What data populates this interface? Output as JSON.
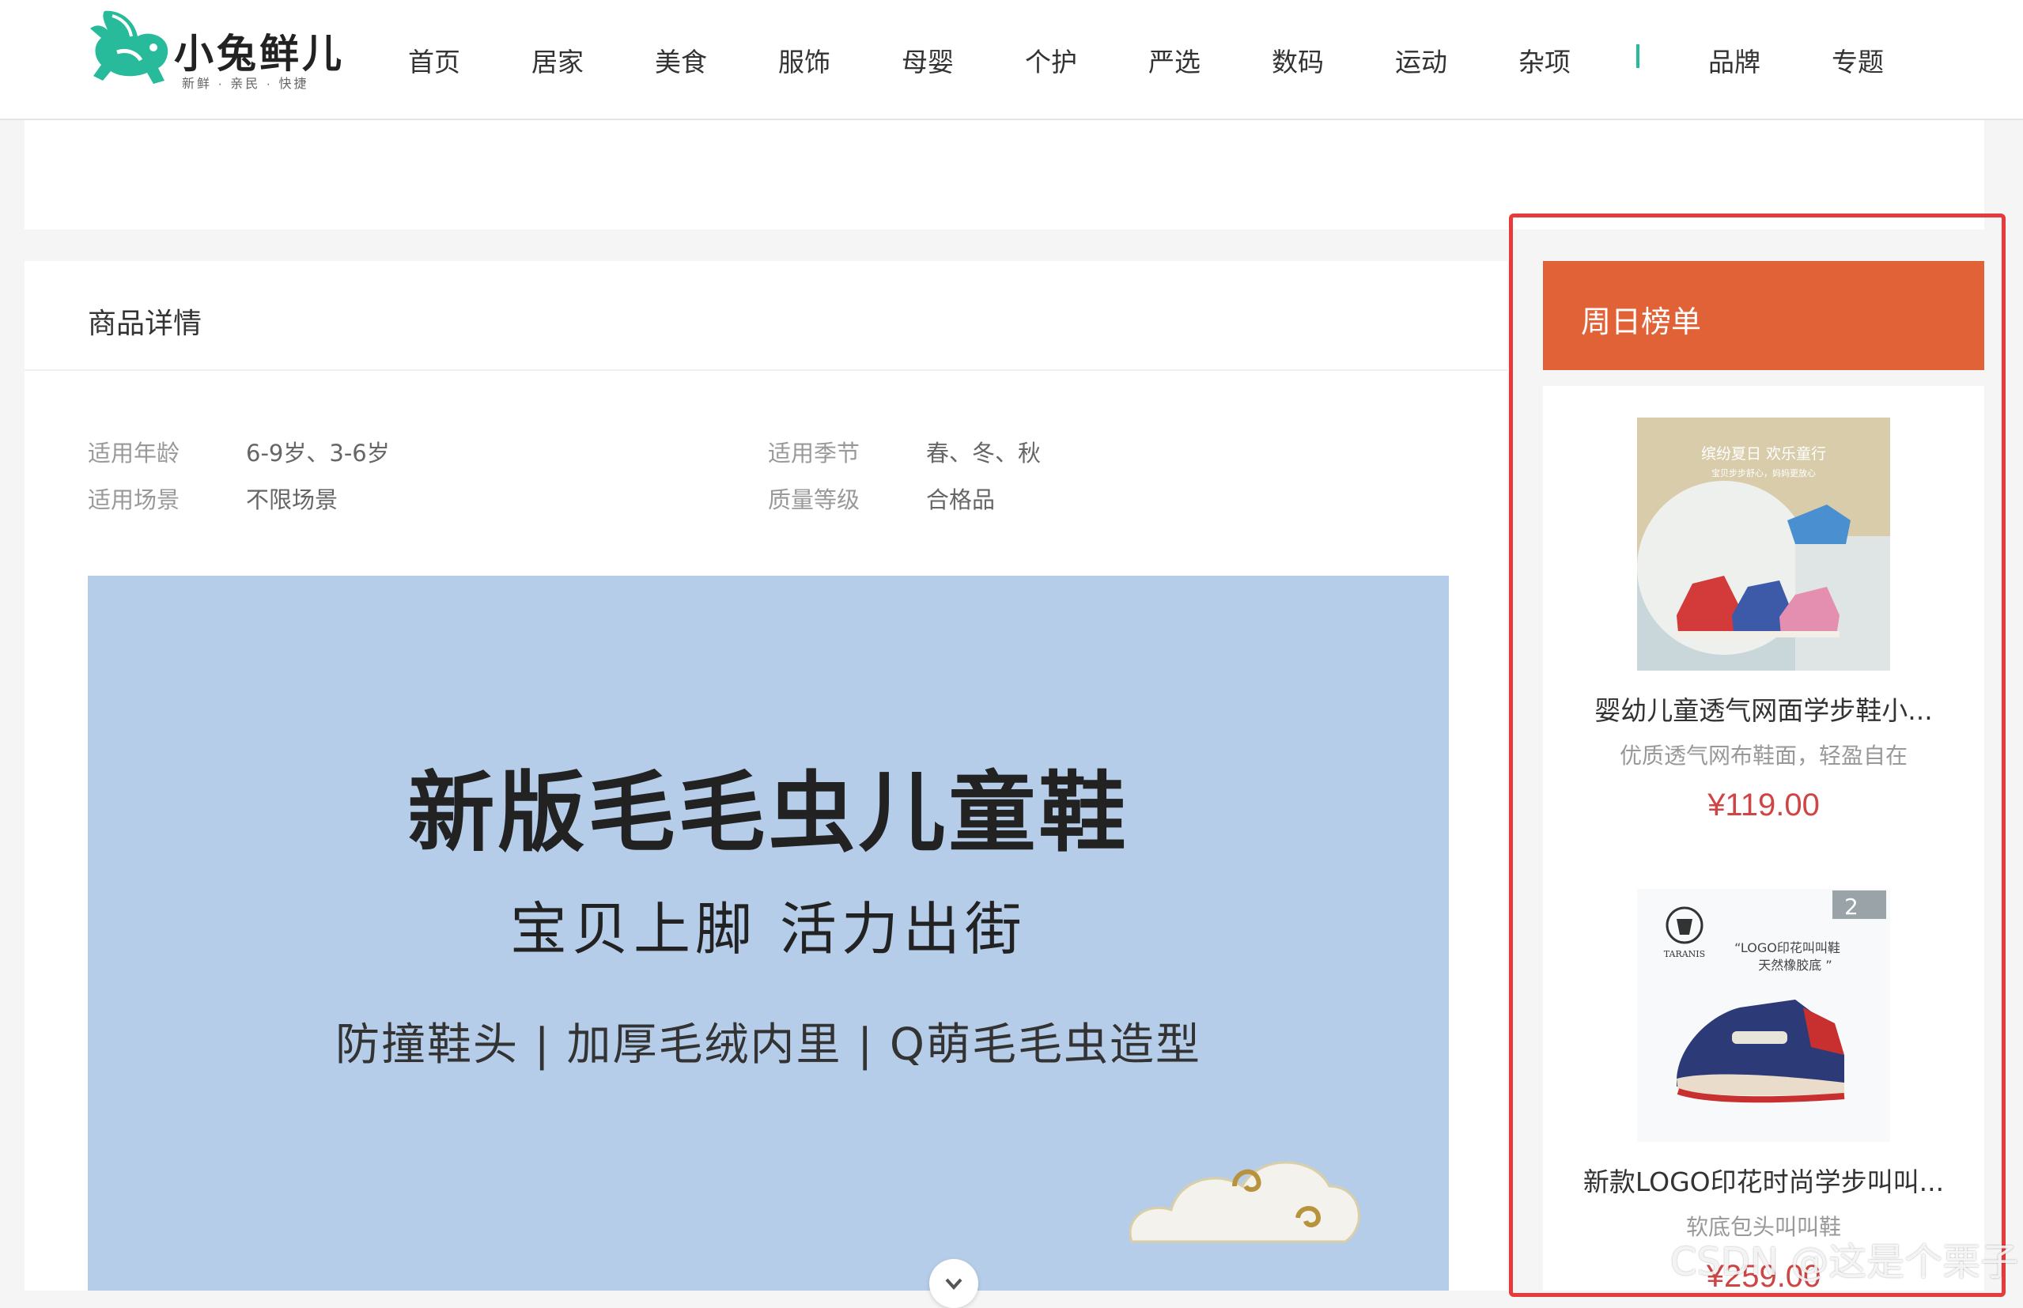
{
  "header": {
    "logo": {
      "name": "小兔鲜儿",
      "slogan": "新鲜 · 亲民 · 快捷"
    },
    "nav": [
      "首页",
      "居家",
      "美食",
      "服饰",
      "母婴",
      "个护",
      "严选",
      "数码",
      "运动",
      "杂项"
    ],
    "nav_extra": [
      "品牌",
      "专题"
    ]
  },
  "details": {
    "title": "商品详情",
    "attributes": [
      {
        "name": "适用年龄",
        "value": "6-9岁、3-6岁"
      },
      {
        "name": "适用季节",
        "value": "春、冬、秋"
      },
      {
        "name": "适用场景",
        "value": "不限场景"
      },
      {
        "name": "质量等级",
        "value": "合格品"
      }
    ],
    "banner": {
      "title": "新版毛毛虫儿童鞋",
      "subtitle": "宝贝上脚 活力出街",
      "features": "防撞鞋头 | 加厚毛绒内里 | Q萌毛毛虫造型"
    }
  },
  "ranking": {
    "title": "周日榜单",
    "items": [
      {
        "name": "婴幼儿童透气网面学步鞋小...",
        "desc": "优质透气网布鞋面，轻盈自在",
        "price": "¥119.00",
        "image_caption": "缤纷夏日 欢乐童行",
        "image_subcaption": "宝贝步步舒心，妈妈更放心"
      },
      {
        "name": "新款LOGO印花时尚学步叫叫...",
        "desc": "软底包头叫叫鞋",
        "price": "¥259.00",
        "image_brand": "TARANIS",
        "image_caption": "“LOGO印花叫叫鞋",
        "image_subcaption": "天然橡胶底 ”",
        "image_badge": "2"
      }
    ]
  },
  "watermark": "CSDN @这是个栗子",
  "colors": {
    "brand": "#27ba9b",
    "rank_header": "#e26237",
    "price": "#cf4444",
    "highlight_border": "#e83a3a"
  }
}
